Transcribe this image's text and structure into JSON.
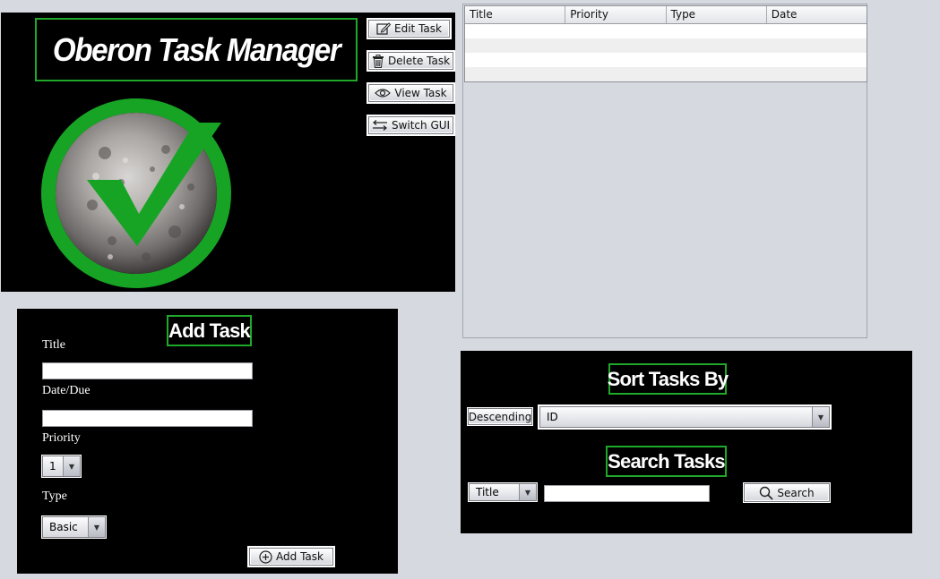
{
  "header": {
    "title": "Oberon Task Manager",
    "buttons": {
      "edit": "Edit Task",
      "delete": "Delete Task",
      "view": "View Task",
      "switch": "Switch GUI"
    }
  },
  "table": {
    "columns": [
      "Title",
      "Priority",
      "Type",
      "Date"
    ],
    "rows": [
      [
        "",
        "",
        "",
        ""
      ],
      [
        "",
        "",
        "",
        ""
      ],
      [
        "",
        "",
        "",
        ""
      ],
      [
        "",
        "",
        "",
        ""
      ]
    ]
  },
  "add_task": {
    "heading": "Add Task",
    "title_label": "Title",
    "title_value": "",
    "date_label": "Date/Due",
    "date_value": "",
    "priority_label": "Priority",
    "priority_value": "1",
    "type_label": "Type",
    "type_value": "Basic",
    "submit_label": "Add Task"
  },
  "sort": {
    "heading": "Sort Tasks By",
    "order_label": "Descending",
    "field_value": "ID"
  },
  "search": {
    "heading": "Search Tasks",
    "field_value": "Title",
    "query": "",
    "button_label": "Search"
  },
  "colors": {
    "accent_green": "#1fa82a",
    "panel_bg": "#000000",
    "window_bg": "#d7d9e0"
  },
  "icons": {
    "edit": "edit-icon",
    "delete": "trash-icon",
    "view": "eye-icon",
    "switch": "swap-arrows-icon",
    "add": "plus-circle-icon",
    "search": "search-icon",
    "logo": "moon-checkmark-logo"
  }
}
